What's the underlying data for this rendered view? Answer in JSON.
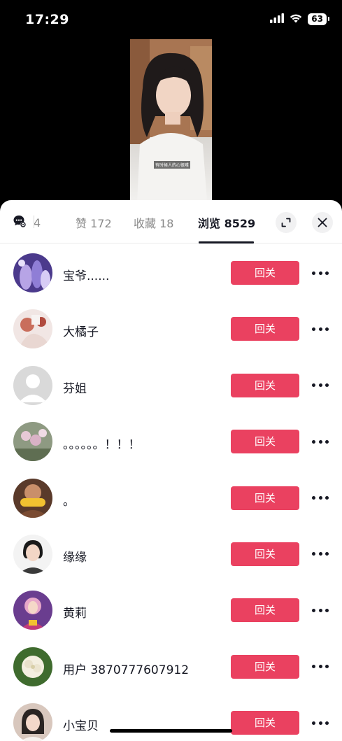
{
  "status_bar": {
    "time": "17:29",
    "battery": "63",
    "icons": [
      "signal-icon",
      "wifi-icon",
      "battery-icon"
    ]
  },
  "video": {
    "subtitle": "有时候人的心很难"
  },
  "tabs": {
    "comments_count": "4",
    "likes": "赞 172",
    "favorites": "收藏 18",
    "views": "浏览 8529"
  },
  "follow_label": "回关",
  "users": [
    {
      "name": "宝爷......"
    },
    {
      "name": "大橘子"
    },
    {
      "name": "芬姐"
    },
    {
      "name": "。。。。。。！！！"
    },
    {
      "name": "。"
    },
    {
      "name": "缘缘"
    },
    {
      "name": "黄莉"
    },
    {
      "name": "用户 3870777607912"
    },
    {
      "name": "小宝贝"
    }
  ],
  "colors": {
    "accent": "#ea4160",
    "text": "#161823",
    "muted": "#8a8a8a"
  }
}
